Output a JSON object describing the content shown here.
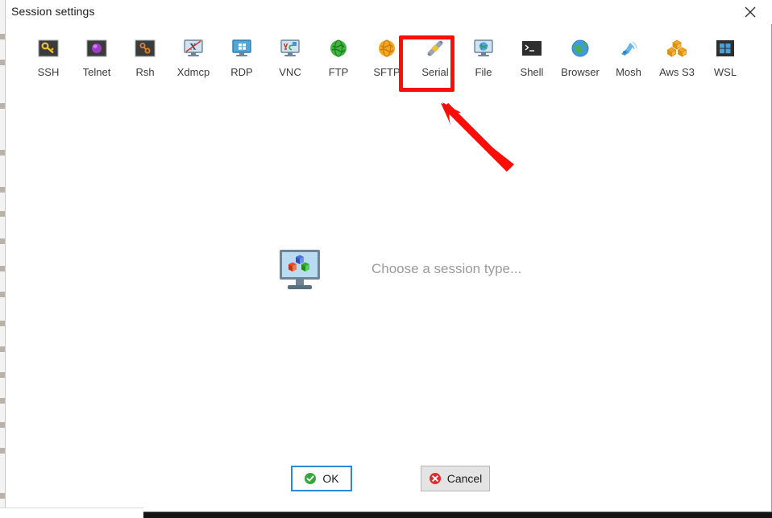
{
  "window": {
    "title": "Session settings",
    "close_icon": "close-icon"
  },
  "session_types": [
    {
      "label": "SSH",
      "icon": "ssh-icon"
    },
    {
      "label": "Telnet",
      "icon": "telnet-icon"
    },
    {
      "label": "Rsh",
      "icon": "rsh-icon"
    },
    {
      "label": "Xdmcp",
      "icon": "xdmcp-icon"
    },
    {
      "label": "RDP",
      "icon": "rdp-icon"
    },
    {
      "label": "VNC",
      "icon": "vnc-icon"
    },
    {
      "label": "FTP",
      "icon": "ftp-icon"
    },
    {
      "label": "SFTP",
      "icon": "sftp-icon"
    },
    {
      "label": "Serial",
      "icon": "serial-icon"
    },
    {
      "label": "File",
      "icon": "file-icon"
    },
    {
      "label": "Shell",
      "icon": "shell-icon"
    },
    {
      "label": "Browser",
      "icon": "browser-icon"
    },
    {
      "label": "Mosh",
      "icon": "mosh-icon"
    },
    {
      "label": "Aws S3",
      "icon": "aws-s3-icon"
    },
    {
      "label": "WSL",
      "icon": "wsl-icon"
    }
  ],
  "main": {
    "placeholder_text": "Choose a session type...",
    "placeholder_icon": "monitor-cubes-icon"
  },
  "footer": {
    "ok_label": "OK",
    "ok_icon": "green-check-icon",
    "cancel_label": "Cancel",
    "cancel_icon": "red-x-icon"
  },
  "annotations": {
    "highlight_target": "Serial",
    "highlight_color": "#fb0d08",
    "arrow_color": "#fb0d08"
  },
  "colors": {
    "focus_border": "#2f87d8",
    "button_face": "#e4e4e4",
    "placeholder_text": "#9b9b9b",
    "title_text": "#1b1b1b"
  }
}
